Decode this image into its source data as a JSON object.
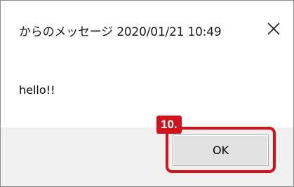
{
  "dialog": {
    "title": "からのメッセージ 2020/01/21 10:49",
    "message": "hello!!",
    "ok_label": "OK"
  },
  "annotation": {
    "step_label": "10.",
    "highlight_color": "#d3131c"
  }
}
